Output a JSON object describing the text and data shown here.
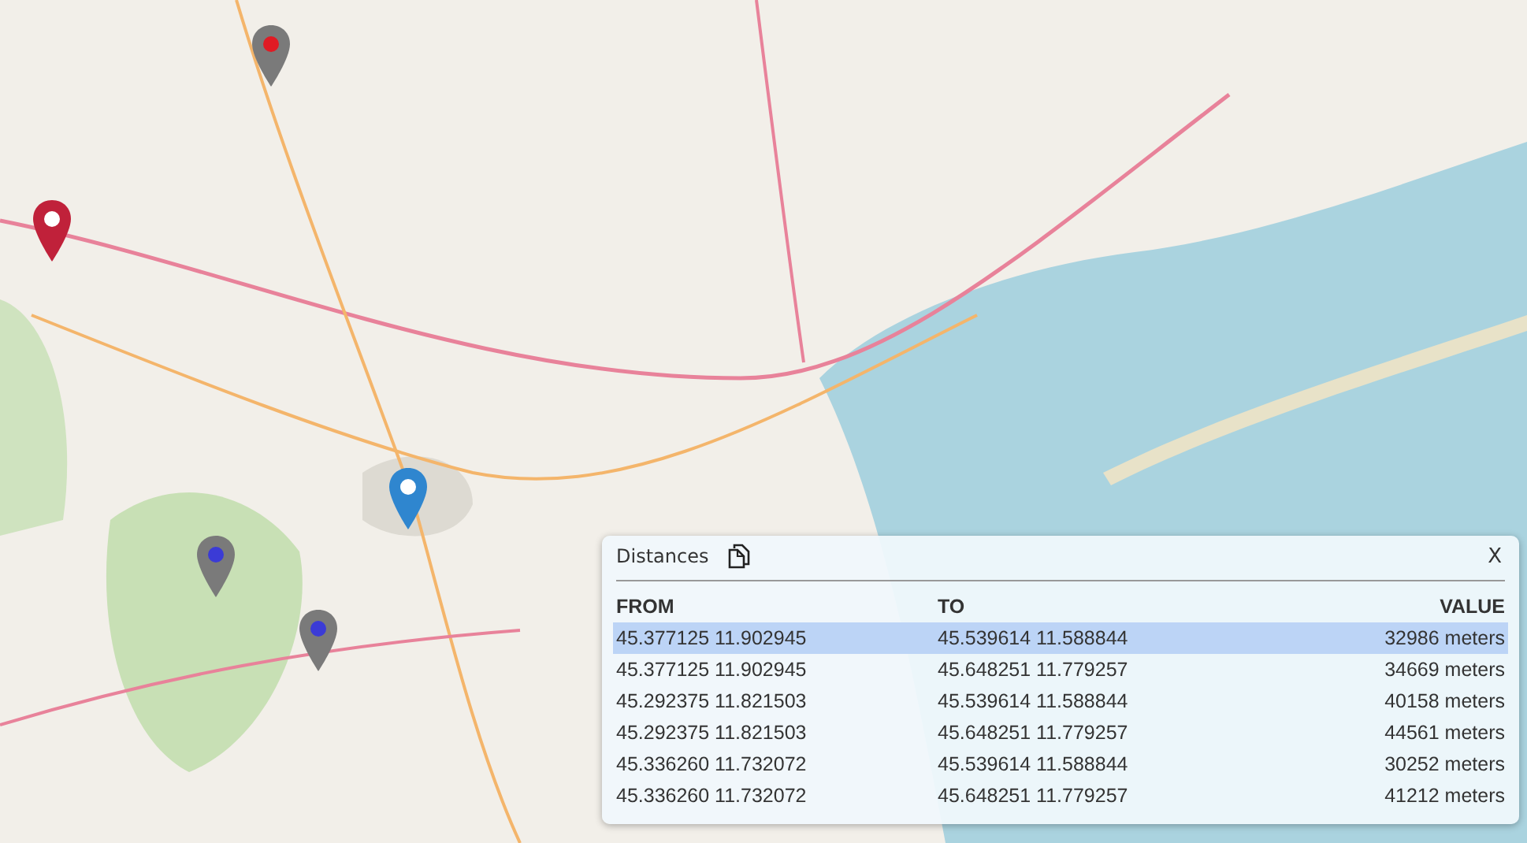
{
  "markers": [
    {
      "color": "#7a7a7a",
      "dot": {
        "color": "#e01b24"
      }
    },
    {
      "color": "#c0213a",
      "dot": {
        "color": "#ffffff"
      }
    },
    {
      "color": "#2f86cf",
      "dot": {
        "color": "#ffffff"
      }
    },
    {
      "color": "#7a7a7a",
      "dot": {
        "color": "#3b3bd6"
      }
    },
    {
      "color": "#7a7a7a",
      "dot": {
        "color": "#3b3bd6"
      }
    }
  ],
  "panel": {
    "title": "Distances",
    "close": "X",
    "columns": [
      "FROM",
      "TO",
      "VALUE"
    ],
    "rows": [
      {
        "from": "45.377125 11.902945",
        "to": "45.539614 11.588844",
        "value": "32986 meters",
        "selected": true
      },
      {
        "from": "45.377125 11.902945",
        "to": "45.648251 11.779257",
        "value": "34669 meters",
        "selected": false
      },
      {
        "from": "45.292375 11.821503",
        "to": "45.539614 11.588844",
        "value": "40158 meters",
        "selected": false
      },
      {
        "from": "45.292375 11.821503",
        "to": "45.648251 11.779257",
        "value": "44561 meters",
        "selected": false
      },
      {
        "from": "45.336260 11.732072",
        "to": "45.539614 11.588844",
        "value": "30252 meters",
        "selected": false
      },
      {
        "from": "45.336260 11.732072",
        "to": "45.648251 11.779257",
        "value": "41212 meters",
        "selected": false
      }
    ]
  }
}
